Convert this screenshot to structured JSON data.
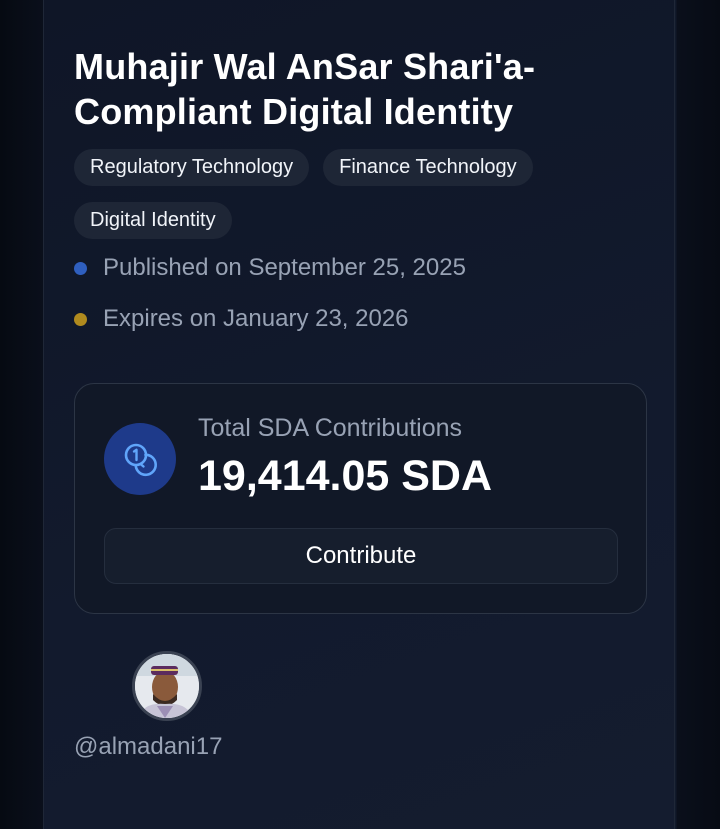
{
  "listing": {
    "title": "Muhajir Wal AnSar Shari'a-Compliant Digital Identity",
    "tags": [
      "Regulatory Technology",
      "Finance Technology",
      "Digital Identity"
    ],
    "published": "Published on September 25, 2025",
    "expires": "Expires on January 23, 2026"
  },
  "contributions": {
    "icon": "coins-icon",
    "label": "Total SDA Contributions",
    "value": "19,414.05 SDA",
    "button_label": "Contribute"
  },
  "author": {
    "avatar_icon": "user-avatar",
    "username": "@almadani17"
  },
  "colors": {
    "published_dot": "#2f5fbf",
    "expires_dot": "#b08a1e",
    "coin_circle": "#1e3a8a",
    "coin_stroke": "#60a5fa"
  }
}
